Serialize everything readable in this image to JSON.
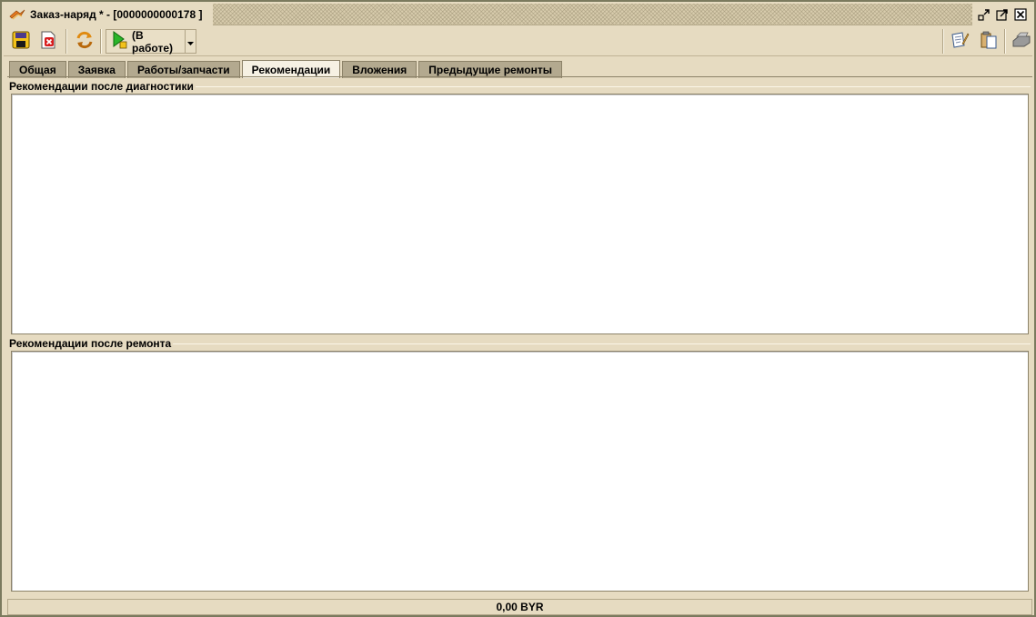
{
  "window": {
    "title": "Заказ-наряд * - [0000000000178 ]"
  },
  "toolbar": {
    "status_label": "(В работе)",
    "icons": [
      "save-icon",
      "cancel-icon",
      "refresh-icon",
      "play-status-icon",
      "dropdown-arrow-icon",
      "edit-doc-icon",
      "clipboard-icon",
      "printer-icon"
    ]
  },
  "tabs": [
    {
      "label": "Общая",
      "active": false
    },
    {
      "label": "Заявка",
      "active": false
    },
    {
      "label": "Работы/запчасти",
      "active": false
    },
    {
      "label": "Рекомендации",
      "active": true
    },
    {
      "label": "Вложения",
      "active": false
    },
    {
      "label": "Предыдущие ремонты",
      "active": false
    }
  ],
  "sections": {
    "diagnostics": {
      "label": "Рекомендации после диагностики",
      "value": ""
    },
    "repair": {
      "label": "Рекомендации после ремонта",
      "value": ""
    }
  },
  "statusbar": {
    "total": "0,00 BYR"
  },
  "colors": {
    "background": "#e6dbc1",
    "tab_inactive": "#b3a98f",
    "tab_active": "#f6f1e3",
    "border": "#8c8268"
  }
}
